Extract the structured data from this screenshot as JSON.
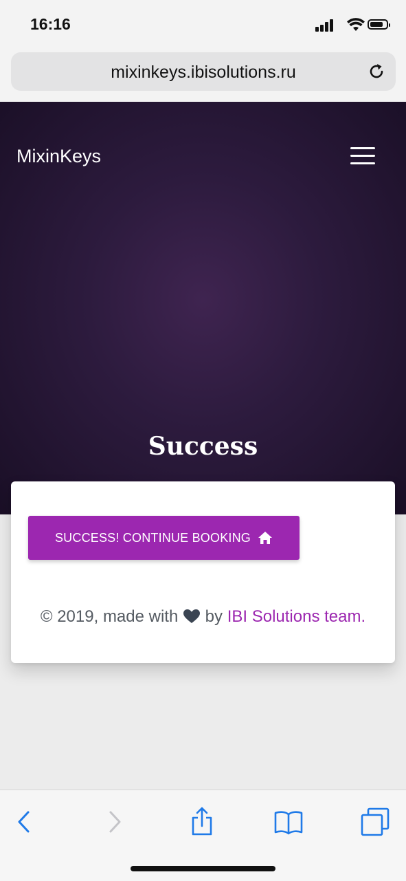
{
  "status_bar": {
    "time": "16:16"
  },
  "browser": {
    "url": "mixinkeys.ibisolutions.ru"
  },
  "site": {
    "brand": "MixinKeys",
    "hero_title": "Success"
  },
  "card": {
    "cta_label": "SUCCESS! CONTINUE BOOKING",
    "footer_prefix": "© 2019, made with",
    "footer_by": "by",
    "footer_link": "IBI Solutions team."
  },
  "colors": {
    "accent": "#9c27b0",
    "ios_blue": "#1f7ae8",
    "hero_dark": "#1a0f26"
  },
  "icons": [
    "signal-icon",
    "wifi-icon",
    "battery-icon",
    "reload-icon",
    "menu-icon",
    "home-icon",
    "heart-icon",
    "back-icon",
    "forward-icon",
    "share-icon",
    "bookmarks-icon",
    "tabs-icon"
  ]
}
